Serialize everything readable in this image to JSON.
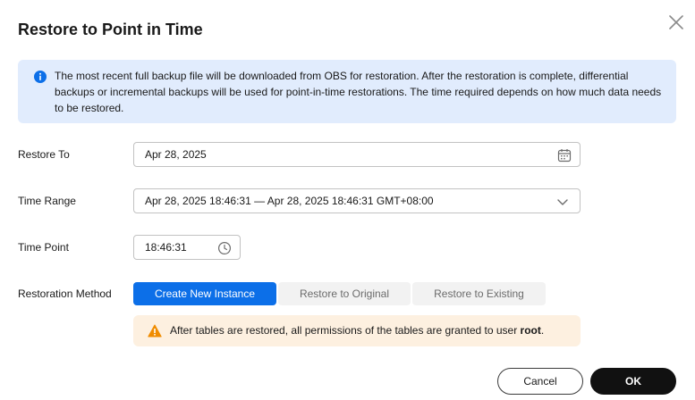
{
  "dialog": {
    "title": "Restore to Point in Time",
    "close_icon": "close-icon"
  },
  "info": {
    "icon": "info-icon",
    "text": "The most recent full backup file will be downloaded from OBS for restoration. After the restoration is complete, differential backups or incremental backups will be used for point-in-time restorations. The time required depends on how much data needs to be restored."
  },
  "form": {
    "restore_to": {
      "label": "Restore To",
      "value": "Apr 28, 2025",
      "icon": "calendar-icon"
    },
    "time_range": {
      "label": "Time Range",
      "value": "Apr 28, 2025 18:46:31 — Apr 28, 2025 18:46:31 GMT+08:00",
      "icon": "chevron-down-icon"
    },
    "time_point": {
      "label": "Time Point",
      "value": "18:46:31",
      "icon": "clock-icon"
    },
    "restoration_method": {
      "label": "Restoration Method",
      "options": [
        "Create New Instance",
        "Restore to Original",
        "Restore to Existing"
      ],
      "selected": "Create New Instance"
    }
  },
  "warning": {
    "icon": "warning-icon",
    "text_before": "After tables are restored, all permissions of the tables are granted to user ",
    "text_bold": "root",
    "text_after": "."
  },
  "footer": {
    "cancel_label": "Cancel",
    "ok_label": "OK"
  },
  "colors": {
    "accent": "#0c6fe8",
    "info_bg": "#e1ecfd",
    "warning_bg": "#fdf0e0",
    "warning_icon": "#f08c00",
    "ok_bg": "#111111"
  }
}
